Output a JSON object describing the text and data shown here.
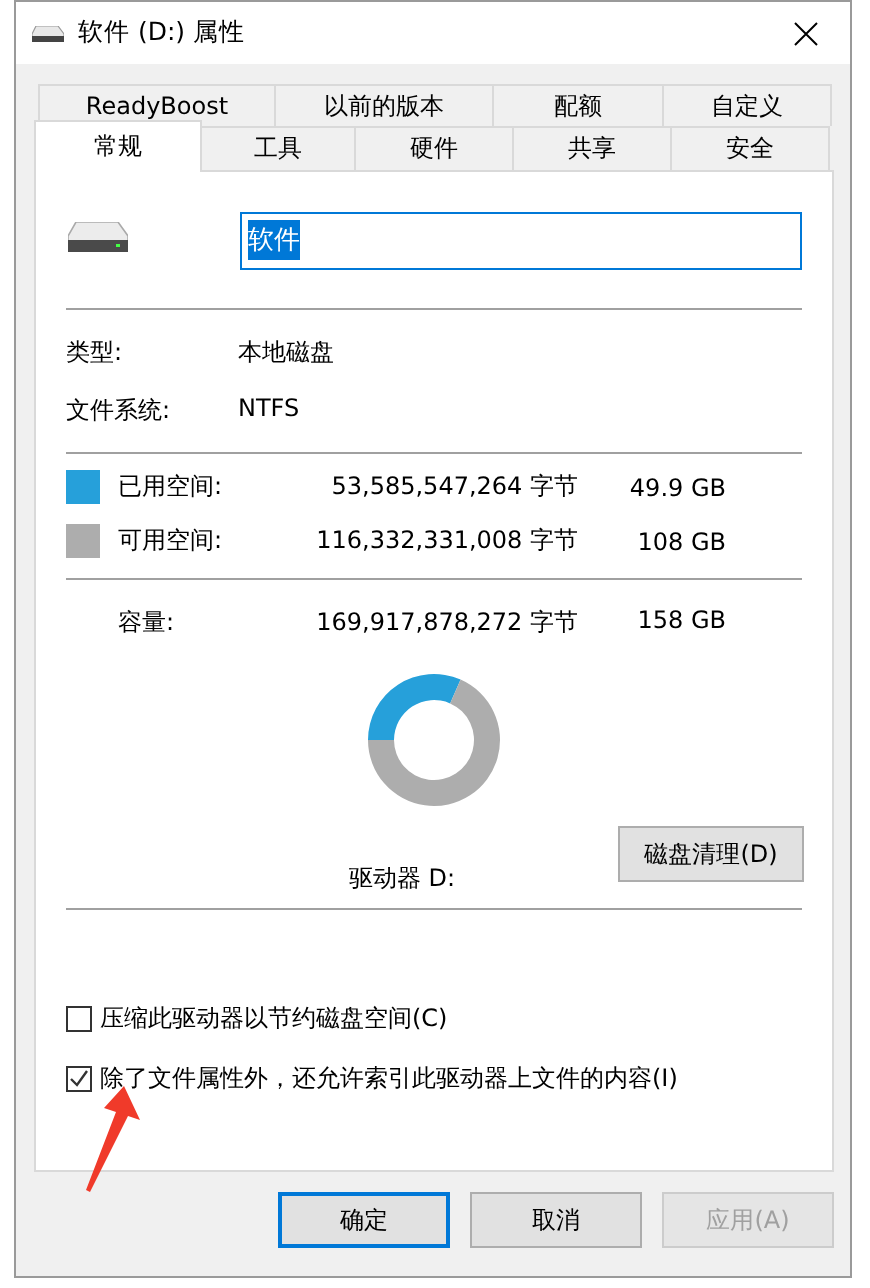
{
  "window": {
    "title": "软件 (D:) 属性"
  },
  "tabs": [
    [
      {
        "label": "ReadyBoost",
        "selected": false
      },
      {
        "label": "以前的版本",
        "selected": false
      },
      {
        "label": "配额",
        "selected": false
      },
      {
        "label": "自定义",
        "selected": false
      }
    ],
    [
      {
        "label": "常规",
        "selected": true
      },
      {
        "label": "工具",
        "selected": false
      },
      {
        "label": "硬件",
        "selected": false
      },
      {
        "label": "共享",
        "selected": false
      },
      {
        "label": "安全",
        "selected": false
      }
    ]
  ],
  "name_field": {
    "value": "软件"
  },
  "info": [
    {
      "label": "类型:",
      "value": "本地磁盘"
    },
    {
      "label": "文件系统:",
      "value": "NTFS"
    }
  ],
  "space": [
    {
      "label": "已用空间:",
      "bytes": "53,585,547,264 字节",
      "size": "49.9 GB",
      "color": "#26a0da"
    },
    {
      "label": "可用空间:",
      "bytes": "116,332,331,008 字节",
      "size": "108 GB",
      "color": "#adadad"
    }
  ],
  "capacity": {
    "label": "容量:",
    "bytes": "169,917,878,272 字节",
    "size": "158 GB"
  },
  "usage": {
    "chart_data": {
      "type": "donut",
      "values": [
        31.6,
        68.4
      ]
    }
  },
  "drive_label": "驱动器 D:",
  "cleanup_button": "磁盘清理(D)",
  "options": [
    {
      "label": "压缩此驱动器以节约磁盘空间(C)",
      "checked": false
    },
    {
      "label": "除了文件属性外，还允许索引此驱动器上文件的内容(I)",
      "checked": true
    }
  ],
  "buttons": [
    {
      "label": "确定",
      "default": true,
      "disabled": false
    },
    {
      "label": "取消",
      "default": false,
      "disabled": false
    },
    {
      "label": "应用(A)",
      "default": false,
      "disabled": true
    }
  ]
}
